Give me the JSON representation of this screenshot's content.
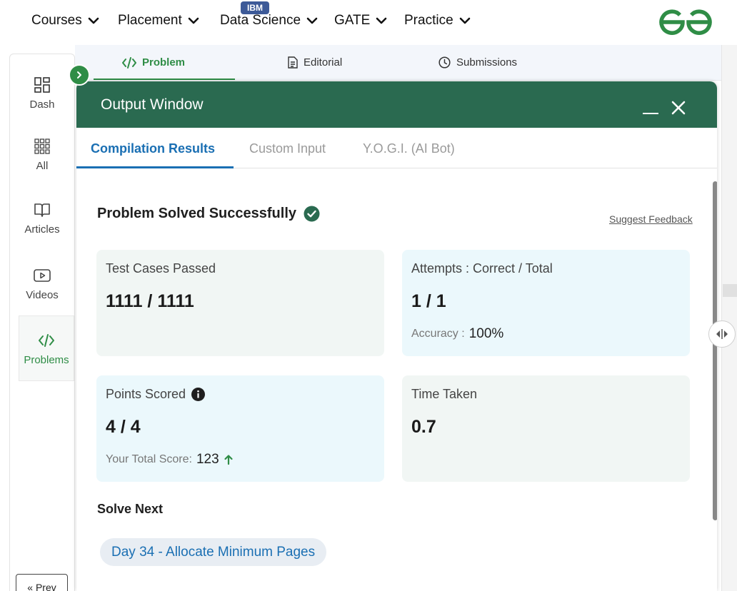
{
  "nav": {
    "items": [
      {
        "label": "Courses"
      },
      {
        "label": "Placement"
      },
      {
        "label": "Data Science"
      },
      {
        "label": "GATE"
      },
      {
        "label": "Practice"
      }
    ],
    "badge": "IBM",
    "logo_icon": "gfg-logo-icon",
    "brand_color": "#2f8d46"
  },
  "sidebar": {
    "items": [
      {
        "label": "Dash",
        "icon": "dashboard-icon"
      },
      {
        "label": "All",
        "icon": "grid-icon"
      },
      {
        "label": "Articles",
        "icon": "book-icon"
      },
      {
        "label": "Videos",
        "icon": "video-icon"
      },
      {
        "label": "Problems",
        "icon": "code-icon",
        "active": true
      }
    ],
    "prev_label": "« Prev"
  },
  "problem_tabs": [
    {
      "label": "Problem",
      "icon": "code-icon",
      "active": true
    },
    {
      "label": "Editorial",
      "icon": "document-icon"
    },
    {
      "label": "Submissions",
      "icon": "clock-icon"
    }
  ],
  "output": {
    "title": "Output Window",
    "header_color": "#2a6a50",
    "tabs": [
      {
        "label": "Compilation Results",
        "active": true
      },
      {
        "label": "Custom Input"
      },
      {
        "label": "Y.O.G.I. (AI Bot)"
      }
    ],
    "status": "Problem Solved Successfully",
    "feedback_link": "Suggest Feedback",
    "cards": {
      "tests": {
        "label": "Test Cases Passed",
        "value": "1111 / 1111"
      },
      "attempts": {
        "label": "Attempts : Correct / Total",
        "value": "1 / 1",
        "sub_label": "Accuracy :",
        "sub_value": "100%"
      },
      "points": {
        "label": "Points Scored",
        "value": "4 / 4",
        "sub_label": "Your Total Score:",
        "sub_value": "123"
      },
      "time": {
        "label": "Time Taken",
        "value": "0.7"
      }
    },
    "solve_next_heading": "Solve Next",
    "next_problem": "Day 34 - Allocate Minimum Pages"
  }
}
